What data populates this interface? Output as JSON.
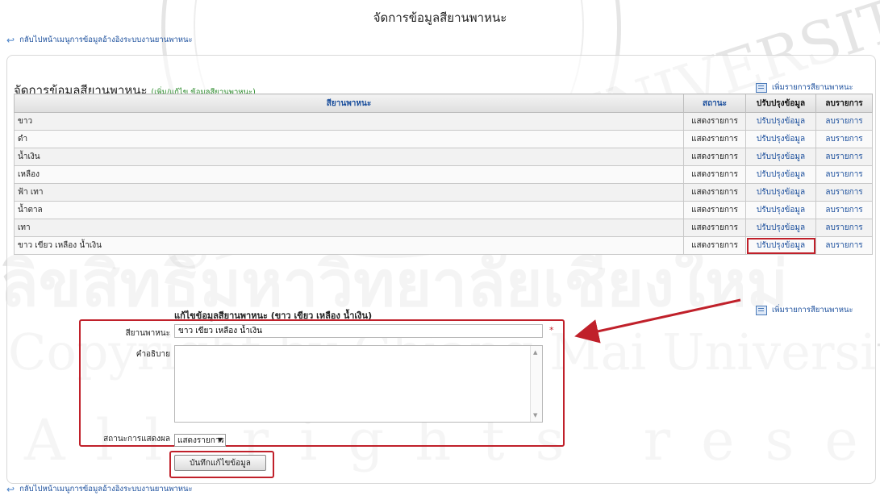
{
  "page_title": "จัดการข้อมูลสียานพาหนะ",
  "back_link_top": "กลับไปหน้าเมนูการข้อมูลอ้างอิงระบบงานยานพาหนะ",
  "back_link_bottom": "กลับไปหน้าเมนูการข้อมูลอ้างอิงระบบงานยานพาหนะ",
  "section": {
    "title": "จัดการข้อมูลสียานพาหนะ",
    "subtitle": "(เพิ่ม/แก้ไข ข้อมูลสียานพาหนะ)"
  },
  "add_item_label": "เพิ่มรายการสียานพาหนะ",
  "table": {
    "headers": [
      "สียานพาหนะ",
      "สถานะ",
      "ปรับปรุงข้อมูล",
      "ลบรายการ"
    ],
    "rows": [
      {
        "color": "ขาว",
        "status": "แสดงรายการ",
        "edit": "ปรับปรุงข้อมูล",
        "delete": "ลบรายการ"
      },
      {
        "color": "ดำ",
        "status": "แสดงรายการ",
        "edit": "ปรับปรุงข้อมูล",
        "delete": "ลบรายการ"
      },
      {
        "color": "น้ำเงิน",
        "status": "แสดงรายการ",
        "edit": "ปรับปรุงข้อมูล",
        "delete": "ลบรายการ"
      },
      {
        "color": "เหลือง",
        "status": "แสดงรายการ",
        "edit": "ปรับปรุงข้อมูล",
        "delete": "ลบรายการ"
      },
      {
        "color": "ฟ้า เทา",
        "status": "แสดงรายการ",
        "edit": "ปรับปรุงข้อมูล",
        "delete": "ลบรายการ"
      },
      {
        "color": "น้ำตาล",
        "status": "แสดงรายการ",
        "edit": "ปรับปรุงข้อมูล",
        "delete": "ลบรายการ"
      },
      {
        "color": "เทา",
        "status": "แสดงรายการ",
        "edit": "ปรับปรุงข้อมูล",
        "delete": "ลบรายการ"
      },
      {
        "color": "ขาว เขียว เหลือง น้ำเงิน",
        "status": "แสดงรายการ",
        "edit": "ปรับปรุงข้อมูล",
        "delete": "ลบรายการ"
      }
    ]
  },
  "edit_form": {
    "heading": "แก้ไขข้อมูลสียานพาหนะ (ขาว เขียว เหลือง น้ำเงิน)",
    "color_label": "สียานพาหนะ",
    "color_value": "ขาว เขียว เหลือง น้ำเงิน",
    "required_mark": "*",
    "description_label": "คำอธิบาย",
    "description_value": "",
    "status_label": "สถานะการแสดงผล",
    "status_value": "แสดงรายการ",
    "save_label": "บันทึกแก้ไขข้อมูล"
  },
  "watermark": {
    "arc_text": "CHIANG MAI UNIVERSITY",
    "thai_line": "ลิขสิทธิ์มหาวิทยาลัยเชียงใหม่",
    "copyright_line": "Copyright by Chiang Mai University",
    "rights_line": "All rights reserved"
  },
  "colors": {
    "link": "#1a4e9c",
    "subtitle_green": "#2a8a2a",
    "highlight_red": "#c0202a"
  },
  "icons": {
    "back": "back-arrow-icon",
    "add": "list-add-icon"
  }
}
